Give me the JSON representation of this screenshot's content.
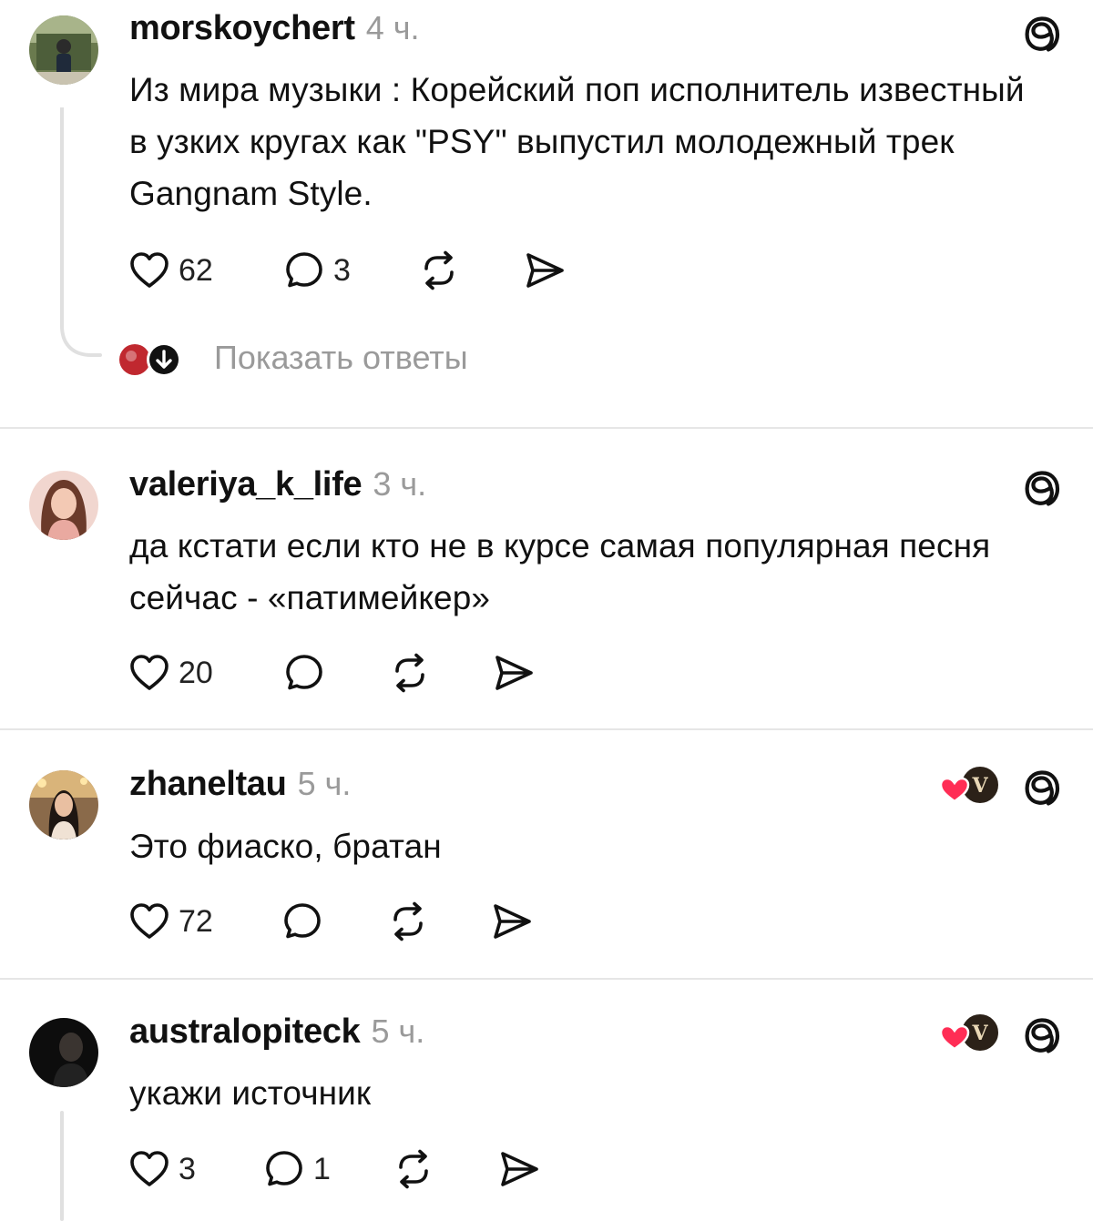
{
  "posts": [
    {
      "username": "morskoychert",
      "time": "4 ч.",
      "text": "Из мира музыки : Корейский поп исполнитель известный в узких кругах как \"PSY\" выпустил молодежный трек Gangnam Style.",
      "likes": "62",
      "replies": "3",
      "show_replies": "Показать ответы"
    },
    {
      "username": "valeriya_k_life",
      "time": "3 ч.",
      "text": "да кстати если кто не в курсе самая популярная песня сейчас - «патимейкер»",
      "likes": "20",
      "replies": ""
    },
    {
      "username": "zhaneltau",
      "time": "5 ч.",
      "text": "Это фиаско, братан",
      "likes": "72",
      "replies": ""
    },
    {
      "username": "australopiteck",
      "time": "5 ч.",
      "text": "укажи источник",
      "likes": "3",
      "replies": "1"
    }
  ],
  "icons": {
    "like": "heart-icon",
    "reply": "speech-bubble-icon",
    "repost": "repost-icon",
    "share": "send-icon",
    "brand": "threads-logo-icon"
  },
  "colors": {
    "text": "#111111",
    "muted": "#9a9a9a",
    "divider": "#e6e6e6",
    "liked_heart": "#ff2d55"
  }
}
